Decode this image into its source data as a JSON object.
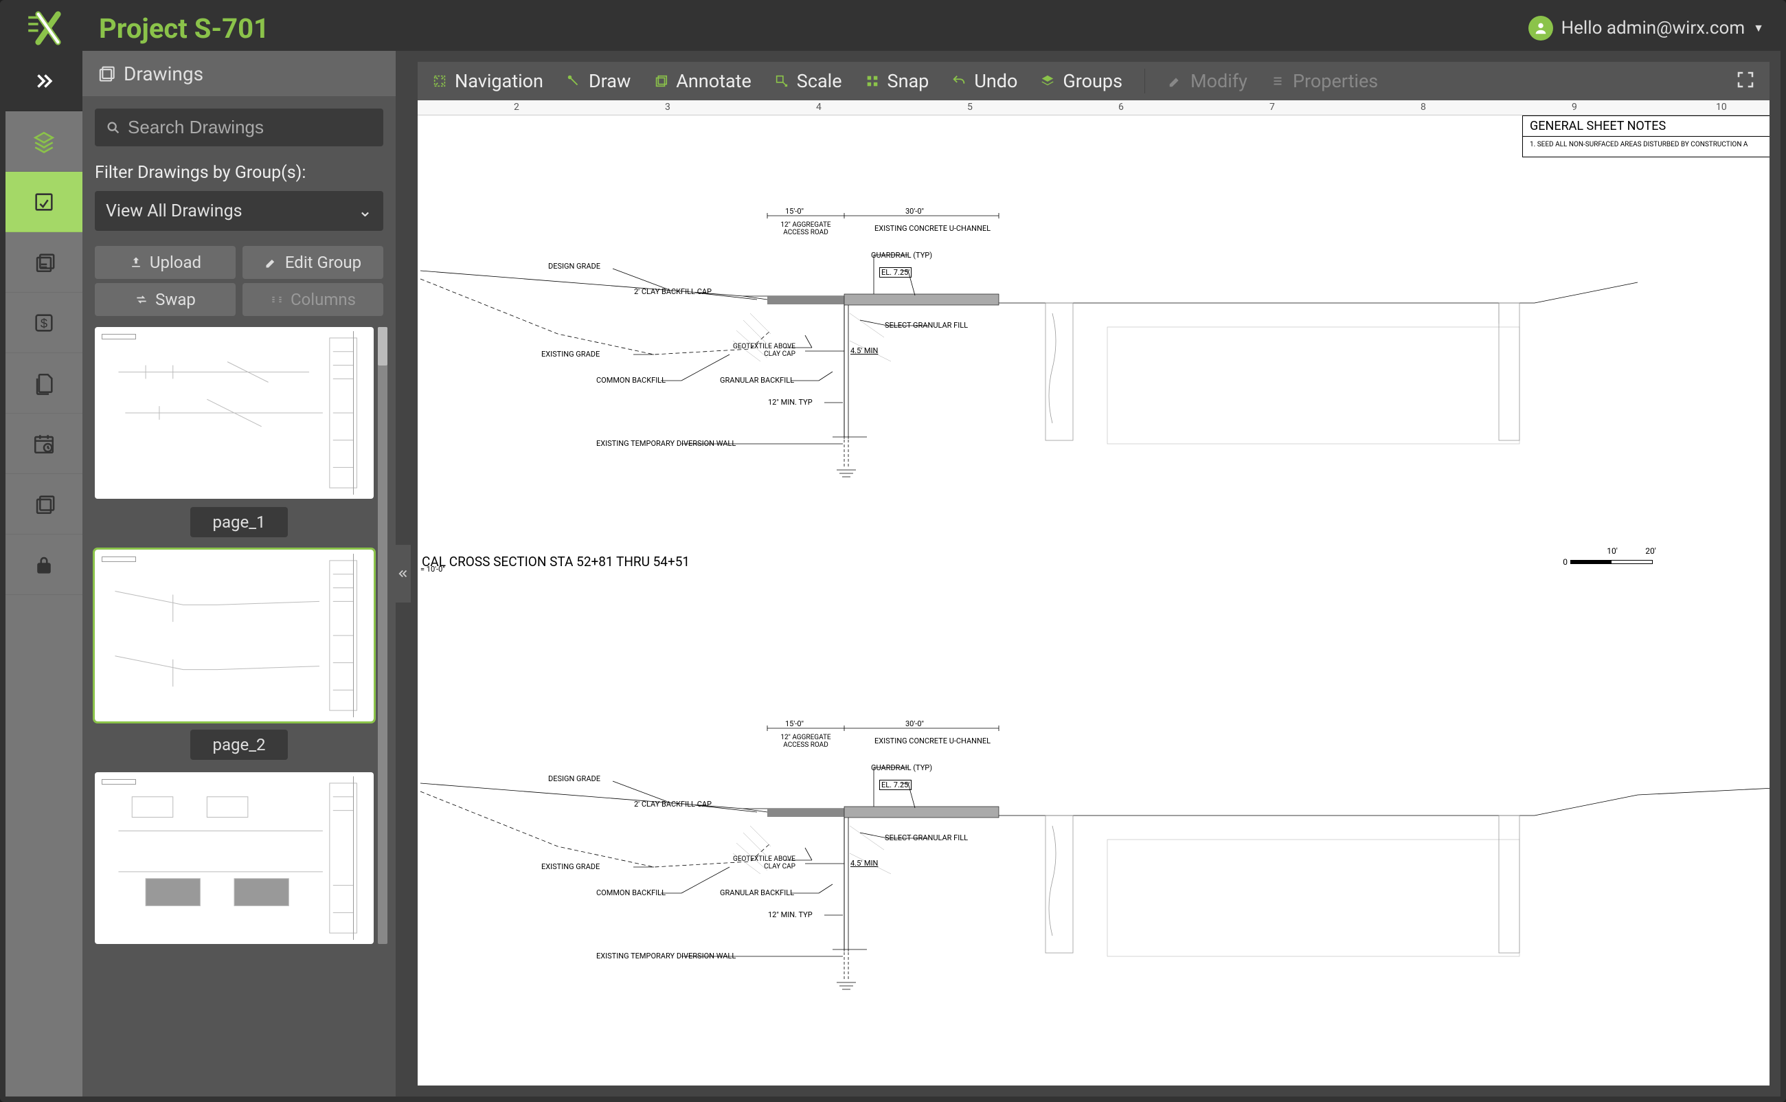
{
  "project_title": "Project S-701",
  "user": {
    "greeting": "Hello admin@wirx.com"
  },
  "sidebar": {
    "header": "Drawings",
    "search_placeholder": "Search Drawings",
    "filter_label": "Filter Drawings by Group(s):",
    "filter_value": "View All Drawings",
    "buttons": {
      "upload": "Upload",
      "edit_group": "Edit Group",
      "swap": "Swap",
      "columns": "Columns"
    },
    "thumbnails": [
      {
        "label": "page_1",
        "selected": false
      },
      {
        "label": "page_2",
        "selected": true
      },
      {
        "label": "",
        "selected": false
      }
    ]
  },
  "toolbar": {
    "navigation": "Navigation",
    "draw": "Draw",
    "annotate": "Annotate",
    "scale": "Scale",
    "snap": "Snap",
    "undo": "Undo",
    "groups": "Groups",
    "modify": "Modify",
    "properties": "Properties"
  },
  "ruler_marks": [
    "2",
    "3",
    "4",
    "5",
    "6",
    "7",
    "8",
    "9",
    "10"
  ],
  "sheet_notes": {
    "header": "GENERAL SHEET NOTES",
    "note1": "1.  SEED ALL NON-SURFACED AREAS DISTURBED BY  CONSTRUCTION A"
  },
  "drawing": {
    "section_title": "CAL CROSS SECTION STA 52+81 THRU 54+51",
    "scale_note": "= 10'-0\"",
    "dim_15": "15'-0\"",
    "dim_30": "30'-0\"",
    "label_aggregate_road": "12\" AGGREGATE ACCESS ROAD",
    "label_existing_uchannel": "EXISTING CONCRETE U-CHANNEL",
    "label_design_grade": "DESIGN GRADE",
    "label_clay_cap": "2' CLAY BACKFILL CAP",
    "label_guardrail": "GUARDRAIL (TYP)",
    "label_el": "EL. 7.25'",
    "label_existing_grade": "EXISTING GRADE",
    "label_select_granular": "SELECT GRANULAR FILL",
    "label_geotextile": "GEOTEXTILE ABOVE CLAY CAP",
    "label_4_5_min": "4.5' MIN",
    "label_common_backfill": "COMMON BACKFILL",
    "label_granular_backfill": "GRANULAR BACKFILL",
    "label_12_min": "12\" MIN. TYP",
    "label_diversion_wall": "EXISTING TEMPORARY DIVERSION WALL",
    "scale_0": "0",
    "scale_10": "10'",
    "scale_20": "20'"
  }
}
